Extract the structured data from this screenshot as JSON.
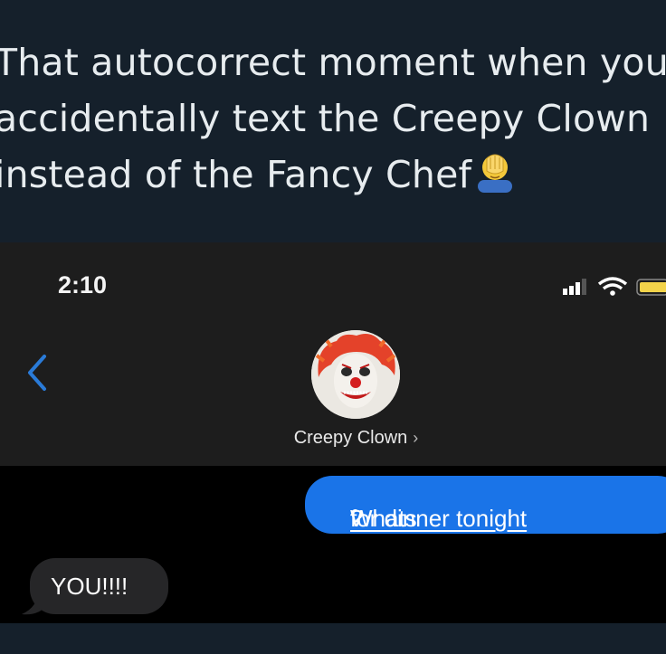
{
  "post": {
    "caption_line1": "That autocorrect moment when you",
    "caption_line2": "accidentally text the Creepy Clown",
    "caption_line3": "instead of the Fancy Chef",
    "emoji": "facepalm-icon"
  },
  "phone": {
    "status_time": "2:10",
    "contact_name": "Creepy Clown",
    "chevron": "›",
    "sent_message": {
      "part1": "Whats ",
      "part2": "for dinner tonight",
      "part3": "?"
    },
    "received_message": "YOU!!!!",
    "colors": {
      "sent_bubble": "#1a74e8",
      "received_bubble": "#262628",
      "back_chevron": "#2a7bd8",
      "battery": "#f3d34a"
    }
  }
}
